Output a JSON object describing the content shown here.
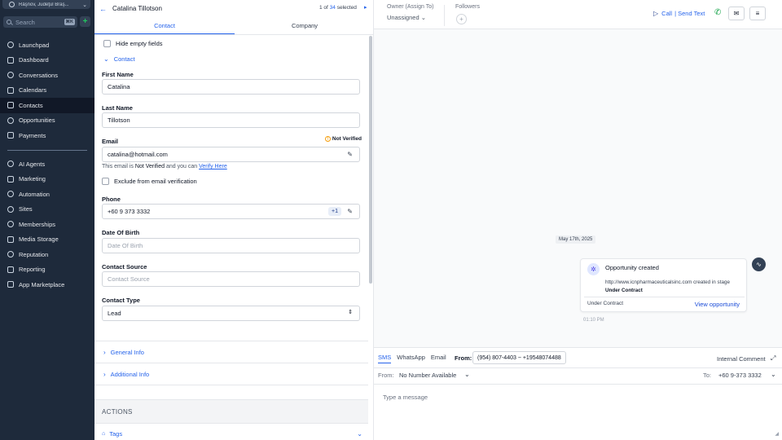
{
  "sidebar": {
    "location": "Râşnov, Judeţul Braş...",
    "search_placeholder": "Search",
    "search_shortcut": "⌘K",
    "add_label": "+",
    "items": [
      {
        "label": "Launchpad",
        "icon": "rocket-icon",
        "active": false
      },
      {
        "label": "Dashboard",
        "icon": "grid-icon",
        "active": false
      },
      {
        "label": "Conversations",
        "icon": "chat-icon",
        "active": false
      },
      {
        "label": "Calendars",
        "icon": "calendar-icon",
        "active": false
      },
      {
        "label": "Contacts",
        "icon": "contacts-icon",
        "active": true
      },
      {
        "label": "Opportunities",
        "icon": "funnel-icon",
        "active": false
      },
      {
        "label": "Payments",
        "icon": "payments-icon",
        "active": false
      }
    ],
    "items2": [
      {
        "label": "AI Agents",
        "icon": "sparkle-icon"
      },
      {
        "label": "Marketing",
        "icon": "send-icon"
      },
      {
        "label": "Automation",
        "icon": "automation-icon"
      },
      {
        "label": "Sites",
        "icon": "globe-icon"
      },
      {
        "label": "Memberships",
        "icon": "badge-icon"
      },
      {
        "label": "Media Storage",
        "icon": "image-icon"
      },
      {
        "label": "Reputation",
        "icon": "star-icon"
      },
      {
        "label": "Reporting",
        "icon": "chart-icon"
      },
      {
        "label": "App Marketplace",
        "icon": "apps-icon"
      }
    ]
  },
  "contact": {
    "name": "Catalina Tillotson",
    "pager_prefix": "1 of",
    "pager_total": "34",
    "pager_suffix": "selected",
    "tabs": [
      "Contact",
      "Company"
    ],
    "hide_empty": "Hide empty fields",
    "section_contact": "Contact",
    "first_name_label": "First Name",
    "first_name": "Catalina",
    "last_name_label": "Last Name",
    "last_name": "Tillotson",
    "email_label": "Email",
    "email_status": "Not Verified",
    "email": "catalina@hotmail.com",
    "email_hint_1": "This email is",
    "email_hint_bold": "Not Verified",
    "email_hint_2": "and you can",
    "email_hint_link": "Verify Here",
    "exclude_label": "Exclude from email verification",
    "phone_label": "Phone",
    "phone": "+60 9 373 3332",
    "phone_code": "+1",
    "dob_label": "Date Of Birth",
    "dob_placeholder": "Date Of Birth",
    "source_label": "Contact Source",
    "source_placeholder": "Contact Source",
    "type_label": "Contact Type",
    "type_value": "Lead",
    "general_info": "General Info",
    "additional_info": "Additional Info",
    "actions": "ACTIONS",
    "tags": "Tags"
  },
  "conversation": {
    "owner_label": "Owner (Assign To)",
    "owner_value": "Unassigned",
    "followers_label": "Followers",
    "call_label": "Call",
    "send_text_label": "| Send Text",
    "date": "May 17th, 2025",
    "card_title": "Opportunity created",
    "card_body": "http://www.icnpharmaceuticalsinc.com created in stage",
    "card_stage_bold": "Under Contract",
    "card_stage": "Under Contract",
    "card_link": "View opportunity",
    "time": "01:10 PM",
    "channels": [
      "SMS",
      "WhatsApp",
      "Email"
    ],
    "from_top_label": "From:",
    "from_top_value": "(954) 807-4403 ~ +19548074488",
    "internal_comment": "Internal Comment",
    "from_label": "From:",
    "from_value": "No Number Available",
    "to_label": "To:",
    "to_value": "+60 9-373 3332",
    "message_placeholder": "Type a message"
  }
}
